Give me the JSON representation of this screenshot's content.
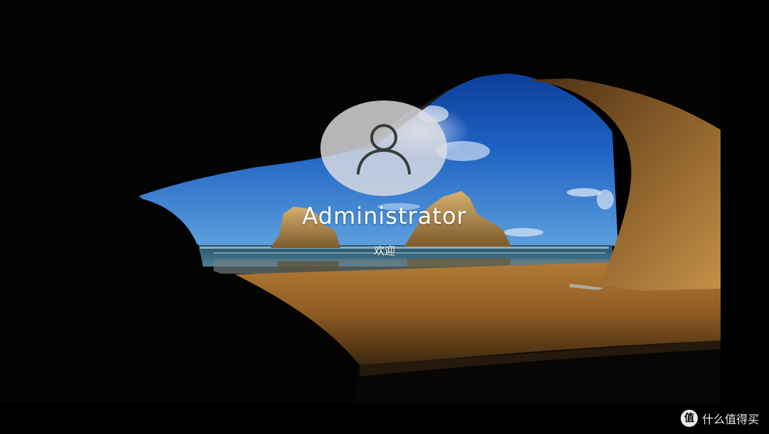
{
  "lock_screen": {
    "username": "Administrator",
    "status": "欢迎",
    "avatar_icon": "user-icon"
  },
  "watermark": {
    "text": "什么值得买",
    "logo_glyph": "值"
  }
}
